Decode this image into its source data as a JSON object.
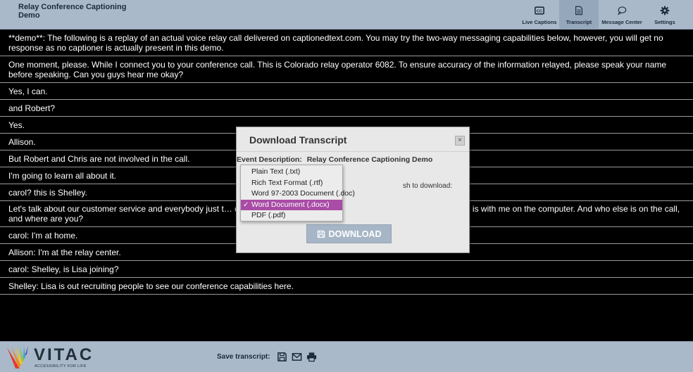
{
  "header": {
    "title": "Relay Conference Captioning Demo",
    "nav": [
      {
        "label": "Live Captions",
        "icon": "cc-icon",
        "active": false
      },
      {
        "label": "Transcript",
        "icon": "document-icon",
        "active": true
      },
      {
        "label": "Message Center",
        "icon": "chat-bubble-icon",
        "active": false
      },
      {
        "label": "Settings",
        "icon": "gear-icon",
        "active": false
      }
    ]
  },
  "transcript": {
    "lines": [
      "**demo**: The following is a replay of an actual voice relay call delivered on captionedtext.com. You may try the two-way messaging capabilities below, however, you will get no response as no captioner is actually present in this demo.",
      "One moment, please. While I connect you to your conference call. This is Colorado relay operator 6082. To ensure accuracy of the information relayed, please speak your name before speaking. Can you guys hear me okay?",
      "Yes, I can.",
      "and Robert?",
      "Yes.",
      "Allison.",
      "But Robert and Chris are not involved in the call.",
      "I'm going to learn all about it.",
      "carol? this is Shelley.",
      "Let's talk about our customer service and everybody just t… d sort of say where you are. I'm here on a cell phone. and mike is with me on the computer. And who else is on the call, and where are you?",
      "carol: I'm at home.",
      "Allison: I'm at the relay center.",
      "carol: Shelley, is Lisa joining?",
      "Shelley: Lisa is out recruiting people to see our conference capabilities here."
    ]
  },
  "modal": {
    "title": "Download Transcript",
    "close_glyph": "×",
    "event_label": "Event Description:",
    "event_value": "Relay Conference Captioning Demo",
    "prompt_fragment": "sh to download:",
    "download_label": "DOWNLOAD"
  },
  "format_select": {
    "options": [
      "Plain Text (.txt)",
      "Rich Text Format (.rtf)",
      "Word 97-2003 Document (.doc)",
      "Word Document (.docx)",
      "PDF (.pdf)"
    ],
    "selected_index": 3,
    "check_glyph": "✓"
  },
  "footer": {
    "logo_text": "VITAC",
    "logo_tagline": "ACCESSIBILITY FOR LIFE",
    "save_label": "Save transcript:",
    "actions": [
      "save-icon",
      "email-icon",
      "print-icon"
    ]
  },
  "colors": {
    "bar_bg": "#a9b9c9",
    "selected_option": "#a94ca6",
    "download_button": "#a6b6c6"
  }
}
